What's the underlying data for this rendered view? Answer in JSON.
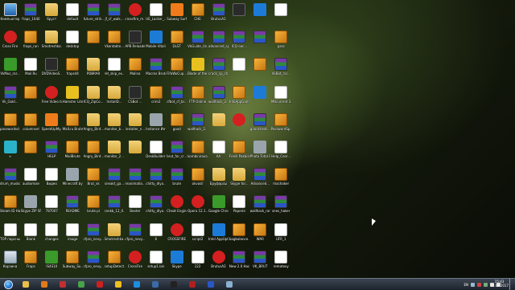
{
  "desktop": {
    "icons": [
      {
        "label": "Компьютер",
        "type": "monitor"
      },
      {
        "label": "fraps_1040",
        "type": "rar"
      },
      {
        "label": "бруст",
        "type": "folder"
      },
      {
        "label": "default",
        "type": "doc"
      },
      {
        "label": "future_strik...",
        "type": "rar"
      },
      {
        "label": "jf_cf_walk...",
        "type": "rar"
      },
      {
        "label": "crossfire_m...",
        "type": "red"
      },
      {
        "label": "UE_Locker_...",
        "type": "doc"
      },
      {
        "label": "Subway Surf",
        "type": "orange"
      },
      {
        "label": "CHE",
        "type": "box"
      },
      {
        "label": "BrutusA2",
        "type": "rar"
      },
      {
        "label": "",
        "type": "dark"
      },
      {
        "label": "",
        "type": "blue"
      },
      {
        "label": "",
        "type": "doc"
      },
      {
        "label": "Cross Fire",
        "type": "red"
      },
      {
        "label": "fraps_run",
        "type": "box"
      },
      {
        "label": "Smotreshka...",
        "type": "folder"
      },
      {
        "label": "desktop",
        "type": "doc"
      },
      {
        "label": "",
        "type": "box"
      },
      {
        "label": "Vkontakte...",
        "type": "box"
      },
      {
        "label": "APB Reloaded",
        "type": "dark"
      },
      {
        "label": "Mobile Vitalik",
        "type": "blue"
      },
      {
        "label": "DLST",
        "type": "box"
      },
      {
        "label": "VkGuide_Us...",
        "type": "rar"
      },
      {
        "label": "advanced_sp...",
        "type": "rar"
      },
      {
        "label": "ICQ-сис...",
        "type": "rar"
      },
      {
        "label": "",
        "type": "rar"
      },
      {
        "label": "pass",
        "type": "box"
      },
      {
        "label": "VkMus_rar...",
        "type": "green"
      },
      {
        "label": "Mail.Ru",
        "type": "doc"
      },
      {
        "label": "DVDVideoS... Free Studio",
        "type": "dark"
      },
      {
        "label": "fraps44",
        "type": "box"
      },
      {
        "label": "PDBRAR",
        "type": "folder"
      },
      {
        "label": "ret_skip_ex...",
        "type": "doc"
      },
      {
        "label": "Malina",
        "type": "box"
      },
      {
        "label": "Macros Brute by [TEA]",
        "type": "rar"
      },
      {
        "label": "FifaWoCup...",
        "type": "box"
      },
      {
        "label": "Blade of the...",
        "type": "yellow"
      },
      {
        "label": "crack_cp_ch...",
        "type": "rar"
      },
      {
        "label": "",
        "type": "doc"
      },
      {
        "label": "",
        "type": "box"
      },
      {
        "label": "VkBot_rar...",
        "type": "rar"
      },
      {
        "label": "Vk_Gold...",
        "type": "rar"
      },
      {
        "label": "",
        "type": "box"
      },
      {
        "label": "Free Video to MP3 Conv...",
        "type": "red"
      },
      {
        "label": "Hamster Lite Archive",
        "type": "yellow"
      },
      {
        "label": "ICQ_ZipCo...",
        "type": "folder"
      },
      {
        "label": "InstallD...",
        "type": "folder"
      },
      {
        "label": "CSBot ...",
        "type": "dark"
      },
      {
        "label": "crim2",
        "type": "box"
      },
      {
        "label": "cfbot_cf_br...",
        "type": "rar"
      },
      {
        "label": "FTP Online",
        "type": "box"
      },
      {
        "label": "wallhack_2...",
        "type": "rar"
      },
      {
        "label": "InfoAppGame...",
        "type": "box"
      },
      {
        "label": "",
        "type": "blue"
      },
      {
        "label": "Mtlcurrent 3",
        "type": "doc"
      },
      {
        "label": "passwordsd...",
        "type": "box"
      },
      {
        "label": "columnsel",
        "type": "box"
      },
      {
        "label": "SpeedUpMy...",
        "type": "orange"
      },
      {
        "label": "MalLru Brute",
        "type": "box"
      },
      {
        "label": "Angry_Bird...",
        "type": "folder"
      },
      {
        "label": "monitor_b...",
        "type": "folder"
      },
      {
        "label": "installer_n...",
        "type": "folder"
      },
      {
        "label": "Instance Интернета",
        "type": "grey"
      },
      {
        "label": "good",
        "type": "box"
      },
      {
        "label": "wallhack_2...",
        "type": "rar"
      },
      {
        "label": "",
        "type": "folder"
      },
      {
        "label": "",
        "type": "red"
      },
      {
        "label": "goodcheat...",
        "type": "rar"
      },
      {
        "label": "PasswordSp...",
        "type": "box"
      },
      {
        "label": "v",
        "type": "cyan"
      },
      {
        "label": "",
        "type": "box"
      },
      {
        "label": "HELP",
        "type": "rar"
      },
      {
        "label": "MailBrute",
        "type": "box"
      },
      {
        "label": "Angry_Bird...",
        "type": "box"
      },
      {
        "label": "monitor_2...",
        "type": "folder"
      },
      {
        "label": "",
        "type": "folder"
      },
      {
        "label": "DeskBuilder 3.0 beta",
        "type": "doc"
      },
      {
        "label": "brut_for_cr...",
        "type": "rar"
      },
      {
        "label": "kombinirovat...",
        "type": "box"
      },
      {
        "label": "AA",
        "type": "doc"
      },
      {
        "label": "Fresh Pakbird...",
        "type": "box"
      },
      {
        "label": "Photo Total Converter",
        "type": "grey"
      },
      {
        "label": "Help_Cenr...",
        "type": "doc"
      },
      {
        "label": "drum_musko...",
        "type": "rar"
      },
      {
        "label": "audiomixe",
        "type": "doc"
      },
      {
        "label": "Видео",
        "type": "doc"
      },
      {
        "label": "Minecraft by minecraft...",
        "type": "grey"
      },
      {
        "label": "Brut_vk",
        "type": "box"
      },
      {
        "label": "sneakt_ga...",
        "type": "rar"
      },
      {
        "label": "reanimatio...",
        "type": "rar"
      },
      {
        "label": "chitty_dlya...",
        "type": "rar"
      },
      {
        "label": "brute",
        "type": "rar"
      },
      {
        "label": "okvasil",
        "type": "box"
      },
      {
        "label": "Бруфорсы",
        "type": "folder"
      },
      {
        "label": "Skype for...",
        "type": "folder"
      },
      {
        "label": "Advanced...",
        "type": "rar"
      },
      {
        "label": "machaker",
        "type": "box"
      },
      {
        "label": "Steam ID Hack",
        "type": "box"
      },
      {
        "label": "Skype ZIP SPACELIST",
        "type": "grey"
      },
      {
        "label": "787007",
        "type": "doc"
      },
      {
        "label": "README",
        "type": "rar"
      },
      {
        "label": "brute.pl",
        "type": "box"
      },
      {
        "label": "snekb_12_0...",
        "type": "rar"
      },
      {
        "label": "Beater",
        "type": "doc"
      },
      {
        "label": "chitty_dlya...",
        "type": "rar"
      },
      {
        "label": "Cheat Engine",
        "type": "red"
      },
      {
        "label": "Opera 12.1...",
        "type": "red"
      },
      {
        "label": "Google Chrome",
        "type": "green"
      },
      {
        "label": "Paperie",
        "type": "doc"
      },
      {
        "label": "wallhack_rar...",
        "type": "rar"
      },
      {
        "label": "snes_haker",
        "type": "rar"
      },
      {
        "label": "TOP парсный и...",
        "type": "doc"
      },
      {
        "label": "Blank",
        "type": "doc"
      },
      {
        "label": "changes",
        "type": "doc"
      },
      {
        "label": "image",
        "type": "doc"
      },
      {
        "label": "cfpro_nevy...",
        "type": "rar"
      },
      {
        "label": "Smotreshka...",
        "type": "folder"
      },
      {
        "label": "cfpro_nevy...",
        "type": "rar"
      },
      {
        "label": "6",
        "type": "doc"
      },
      {
        "label": "CROSSFIRE",
        "type": "red"
      },
      {
        "label": "script2",
        "type": "doc"
      },
      {
        "label": "Intel AppUpC...",
        "type": "blue"
      },
      {
        "label": "bagbalance...",
        "type": "box"
      },
      {
        "label": "WAR",
        "type": "box"
      },
      {
        "label": "UFR_1",
        "type": "doc"
      },
      {
        "label": "Корзина",
        "type": "recycle"
      },
      {
        "label": "Fraps",
        "type": "box"
      },
      {
        "label": "lS4S10",
        "type": "green"
      },
      {
        "label": "Subway_Su...",
        "type": "box"
      },
      {
        "label": "cfpro_nevy...",
        "type": "rar"
      },
      {
        "label": "setupDetect...",
        "type": "box"
      },
      {
        "label": "CrossFire",
        "type": "red"
      },
      {
        "label": "setup1.bin",
        "type": "doc"
      },
      {
        "label": "Skype",
        "type": "blue"
      },
      {
        "label": "122",
        "type": "doc"
      },
      {
        "label": "BrutusA2",
        "type": "red"
      },
      {
        "label": "New 2.0 Hack VK",
        "type": "rar"
      },
      {
        "label": "VK_BRUT",
        "type": "rar"
      },
      {
        "label": "remotexy",
        "type": "doc"
      }
    ]
  },
  "taskbar": {
    "pinned": [
      {
        "name": "explorer",
        "color": "#e8c048"
      },
      {
        "name": "media-player",
        "color": "#e07a1a"
      },
      {
        "name": "cheat",
        "color": "#c03030"
      },
      {
        "name": "chrome",
        "color": "#4aa34a"
      },
      {
        "name": "opera",
        "color": "#cc2020"
      },
      {
        "name": "yandex",
        "color": "#f0c020"
      },
      {
        "name": "skype",
        "color": "#1d8fe0"
      },
      {
        "name": "vk",
        "color": "#3a6aa8"
      },
      {
        "name": "steam",
        "color": "#222222"
      },
      {
        "name": "crossfire",
        "color": "#b02020"
      },
      {
        "name": "word",
        "color": "#2a56c6"
      },
      {
        "name": "notepad",
        "color": "#8ab0d0"
      }
    ],
    "lang": "EN",
    "time": "15:43",
    "date": "11.04.2017"
  }
}
